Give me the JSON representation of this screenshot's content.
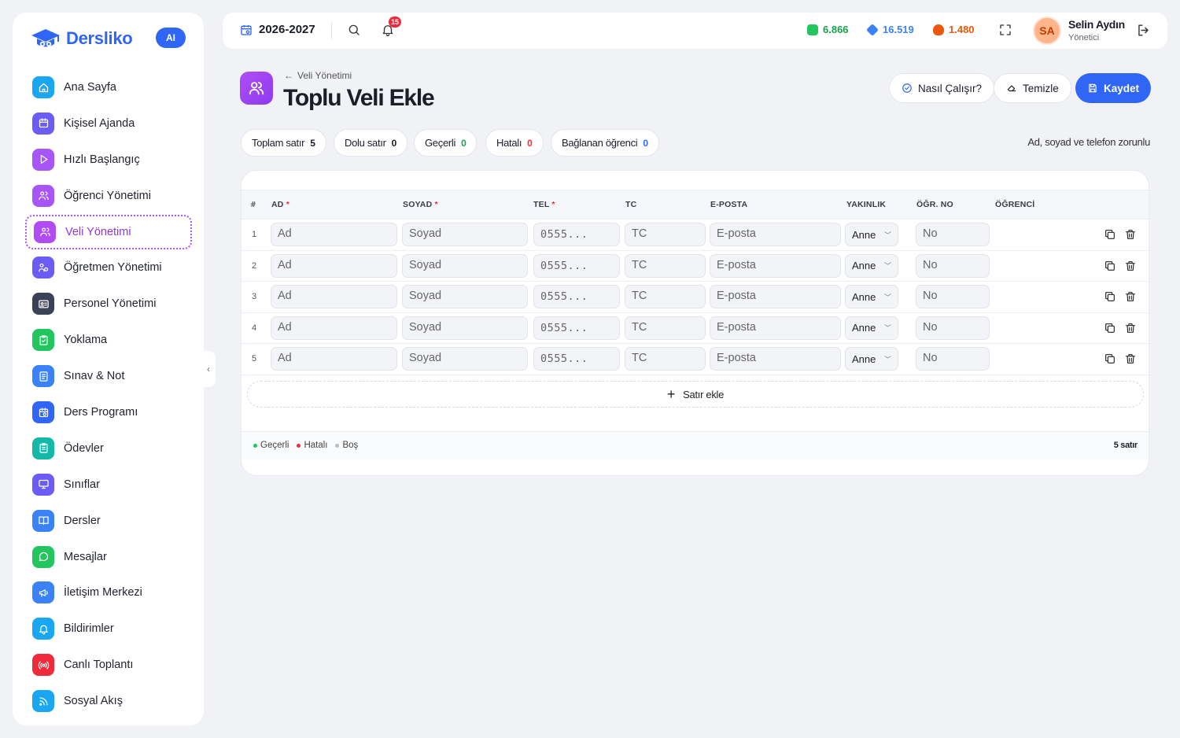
{
  "app": {
    "name": "Dersliko",
    "ai_badge": "AI"
  },
  "sidebar": {
    "items": [
      {
        "label": "Ana Sayfa",
        "icon": "home-icon",
        "color": "#18a7f0"
      },
      {
        "label": "Kişisel Ajanda",
        "icon": "calendar-icon",
        "color": "#6b5cf6"
      },
      {
        "label": "Hızlı Başlangıç",
        "icon": "play-icon",
        "color": "#a855f7"
      },
      {
        "label": "Öğrenci Yönetimi",
        "icon": "users-icon",
        "color": "#a855f7"
      },
      {
        "label": "Veli Yönetimi",
        "icon": "parents-icon",
        "color": "#b14cf5",
        "active": true
      },
      {
        "label": "Öğretmen Yönetimi",
        "icon": "teacher-icon",
        "color": "#6b5cf6"
      },
      {
        "label": "Personel Yönetimi",
        "icon": "id-card-icon",
        "color": "#3a4257"
      },
      {
        "label": "Yoklama",
        "icon": "clipboard-check-icon",
        "color": "#22c55e"
      },
      {
        "label": "Sınav & Not",
        "icon": "exam-icon",
        "color": "#3b82f6"
      },
      {
        "label": "Ders Programı",
        "icon": "schedule-icon",
        "color": "#2f66f6"
      },
      {
        "label": "Ödevler",
        "icon": "homework-icon",
        "color": "#14b8a6"
      },
      {
        "label": "Sınıflar",
        "icon": "monitor-icon",
        "color": "#6b5cf6"
      },
      {
        "label": "Dersler",
        "icon": "book-icon",
        "color": "#3b82f6"
      },
      {
        "label": "Mesajlar",
        "icon": "message-icon",
        "color": "#22c55e"
      },
      {
        "label": "İletişim Merkezi",
        "icon": "megaphone-icon",
        "color": "#3b82f6"
      },
      {
        "label": "Bildirimler",
        "icon": "bell-icon",
        "color": "#18a7f0"
      },
      {
        "label": "Canlı Toplantı",
        "icon": "broadcast-icon",
        "color": "#ef2b3b"
      },
      {
        "label": "Sosyal Akış",
        "icon": "rss-icon",
        "color": "#18a7f0"
      }
    ]
  },
  "topbar": {
    "year": "2026-2027",
    "notification_count": "15",
    "stats": [
      {
        "value": "6.866",
        "color": "#16a34a"
      },
      {
        "value": "16.519",
        "color": "#3b82f6"
      },
      {
        "value": "1.480",
        "color": "#ea580c"
      }
    ],
    "user": {
      "initials": "SA",
      "name": "Selin Aydın",
      "role": "Yönetici"
    }
  },
  "page": {
    "breadcrumb": "Veli Yönetimi",
    "title": "Toplu Veli Ekle",
    "buttons": {
      "how": "Nasıl Çalışır?",
      "clear": "Temizle",
      "save": "Kaydet"
    }
  },
  "chips": [
    {
      "label": "Toplam satır",
      "value": "5",
      "color": "#1b1d29"
    },
    {
      "label": "Dolu satır",
      "value": "0",
      "color": "#1b1d29"
    },
    {
      "label": "Geçerli",
      "value": "0",
      "color": "#16a34a"
    },
    {
      "label": "Hatalı",
      "value": "0",
      "color": "#ef2b3b"
    },
    {
      "label": "Bağlanan öğrenci",
      "value": "0",
      "color": "#2f66f6"
    }
  ],
  "required_note": "Ad, soyad ve telefon zorunlu",
  "table": {
    "headers": {
      "num": "#",
      "ad": "AD",
      "soyad": "SOYAD",
      "tel": "TEL",
      "tc": "TC",
      "eposta": "E-POSTA",
      "yakinlik": "YAKINLIK",
      "ogrno": "ÖĞR. NO",
      "ogrenci": "ÖĞRENCİ",
      "required_mark": "*"
    },
    "placeholders": {
      "ad": "Ad",
      "soyad": "Soyad",
      "tel": "0555...",
      "tc": "TC",
      "eposta": "E-posta",
      "ogrno": "No"
    },
    "rows": [
      {
        "num": "1",
        "yakinlik": "Anne"
      },
      {
        "num": "2",
        "yakinlik": "Anne"
      },
      {
        "num": "3",
        "yakinlik": "Anne"
      },
      {
        "num": "4",
        "yakinlik": "Anne"
      },
      {
        "num": "5",
        "yakinlik": "Anne"
      }
    ],
    "add_row": "Satır ekle"
  },
  "footer": {
    "legend": [
      {
        "label": "Geçerli",
        "color": "#22c55e"
      },
      {
        "label": "Hatalı",
        "color": "#ef2b3b"
      },
      {
        "label": "Boş",
        "color": "#b8bcc6"
      }
    ],
    "row_count": "5 satır"
  }
}
